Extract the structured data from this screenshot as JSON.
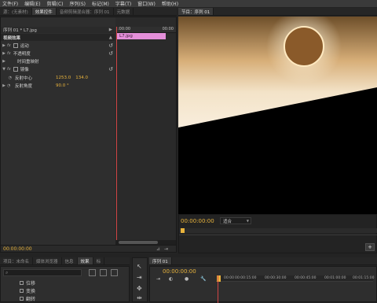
{
  "menu": [
    "文件(F)",
    "编辑(E)",
    "剪辑(C)",
    "序列(S)",
    "标记(M)",
    "字幕(T)",
    "窗口(W)",
    "帮助(H)"
  ],
  "top_tabs": [
    "源：(无素材)",
    "效果控件",
    "音频剪辑混合器：序列 01",
    "元数据"
  ],
  "effect_controls": {
    "clip_path": "序列 01 * L7.jpg",
    "ruler_start": ":00:00",
    "ruler_end": "00:00",
    "section_title": "视频效果",
    "clip_name": "L7.jpg",
    "effects": [
      {
        "name": "运动",
        "fx": true
      },
      {
        "name": "不透明度",
        "fx": true
      },
      {
        "name": "时间重映射",
        "fx": false
      },
      {
        "name": "镜像",
        "fx": true
      }
    ],
    "params": [
      {
        "label": "反射中心",
        "values": [
          "1253.0",
          "134.0"
        ]
      },
      {
        "label": "反射角度",
        "values": [
          "90.0 °"
        ]
      }
    ],
    "timecode": "00:00:00:00"
  },
  "program_monitor": {
    "tab": "节目：序列 01",
    "timecode": "00:00:00:00",
    "fit": "适合"
  },
  "bottom_left": {
    "tabs": [
      "项目：未命名",
      "媒体浏览器",
      "信息",
      "效果",
      "标"
    ],
    "items": [
      "位移",
      "变换",
      "翻转"
    ]
  },
  "timeline": {
    "tab": "序列 01",
    "timecode": "00:00:00:00",
    "ruler": [
      "00:00",
      "00:00:15:00",
      "00:00:30:00",
      "00:00:45:00",
      "00:01:00:00",
      "00:01:15:00"
    ]
  },
  "colors": {
    "accent": "#e8b33c",
    "clip": "#e48fd9",
    "playhead": "#d14545"
  }
}
